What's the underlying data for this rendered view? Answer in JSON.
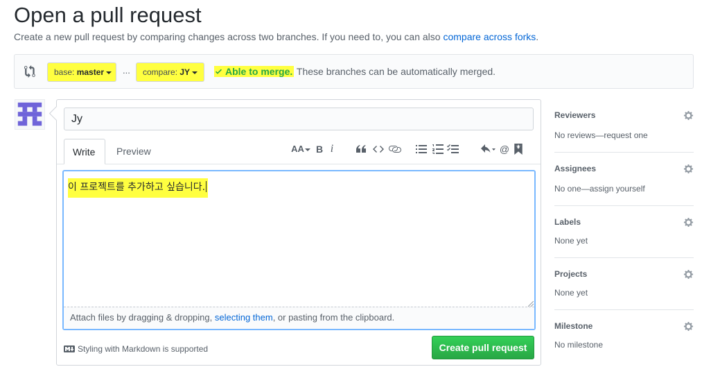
{
  "header": {
    "title": "Open a pull request",
    "subtitle_prefix": "Create a new pull request by comparing changes across two branches. If you need to, you can also ",
    "subtitle_link": "compare across forks",
    "subtitle_suffix": "."
  },
  "range": {
    "base_prefix": "base:",
    "base_branch": "master",
    "ellipsis": "...",
    "compare_prefix": "compare:",
    "compare_branch": "JY",
    "merge_status": "Able to merge.",
    "merge_message": "These branches can be automatically merged."
  },
  "form": {
    "title_value": "Jy",
    "tabs": [
      "Write",
      "Preview"
    ],
    "body_value": "이 프로젝트를 추가하고 싶습니다.",
    "drop_prefix": "Attach files by dragging & dropping, ",
    "drop_link": "selecting them",
    "drop_suffix": ", or pasting from the clipboard.",
    "markdown_note": "Styling with Markdown is supported",
    "submit_label": "Create pull request"
  },
  "toolbar": {
    "header_text": "AA",
    "bold": "B",
    "italic": "i",
    "mention": "@"
  },
  "sidebar": {
    "items": [
      {
        "heading": "Reviewers",
        "value": "No reviews—request one"
      },
      {
        "heading": "Assignees",
        "value": "No one—assign yourself"
      },
      {
        "heading": "Labels",
        "value": "None yet"
      },
      {
        "heading": "Projects",
        "value": "None yet"
      },
      {
        "heading": "Milestone",
        "value": "No milestone"
      }
    ]
  },
  "colors": {
    "link": "#0366d6",
    "success": "#28a745",
    "highlight": "#ffff40",
    "focus_border": "#79b8ff",
    "avatar": "#6f64d9"
  },
  "icons": [
    "git-compare-icon",
    "check-icon",
    "gear-icon",
    "markdown-icon",
    "avatar-identicon"
  ]
}
